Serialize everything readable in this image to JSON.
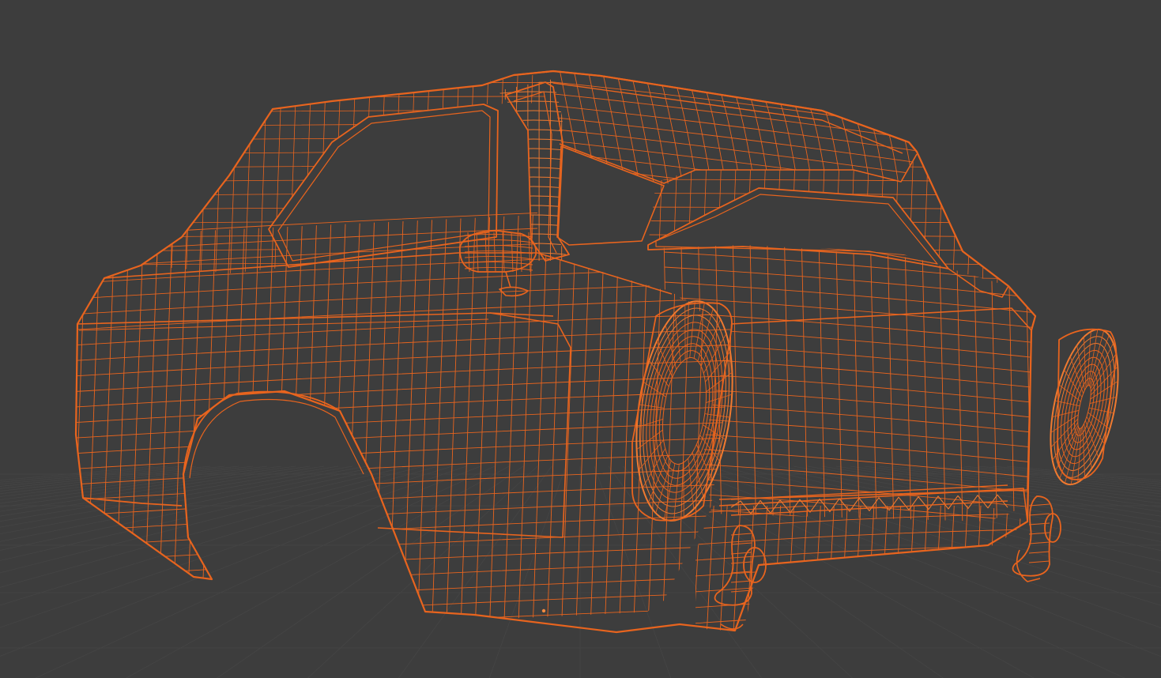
{
  "viewport": {
    "mode": "wireframe",
    "object": "car-body-rear",
    "colors": {
      "background": "#3d3d3d",
      "floor_grid": "#454545",
      "wire": "#e8641e",
      "wire_dense": "#f07a30",
      "origin_point": "#f28a40"
    }
  }
}
